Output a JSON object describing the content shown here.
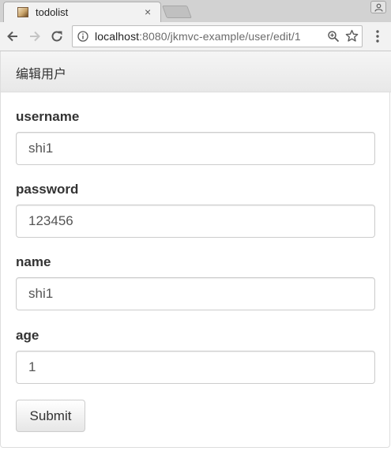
{
  "browser": {
    "tab_title": "todolist",
    "tab_close": "×",
    "url_host": "localhost",
    "url_rest": ":8080/jkmvc-example/user/edit/1"
  },
  "panel": {
    "title": "编辑用户"
  },
  "form": {
    "username": {
      "label": "username",
      "value": "shi1"
    },
    "password": {
      "label": "password",
      "value": "123456"
    },
    "name": {
      "label": "name",
      "value": "shi1"
    },
    "age": {
      "label": "age",
      "value": "1"
    },
    "submit_label": "Submit"
  },
  "colors": {
    "panel_heading_bg": "#f5f5f5",
    "input_border": "#cccccc",
    "label_text": "#333333"
  },
  "icons": [
    "back-arrow-icon",
    "forward-arrow-icon",
    "reload-icon",
    "info-icon",
    "zoom-icon",
    "star-icon",
    "menu-icon",
    "profile-icon",
    "favicon"
  ]
}
